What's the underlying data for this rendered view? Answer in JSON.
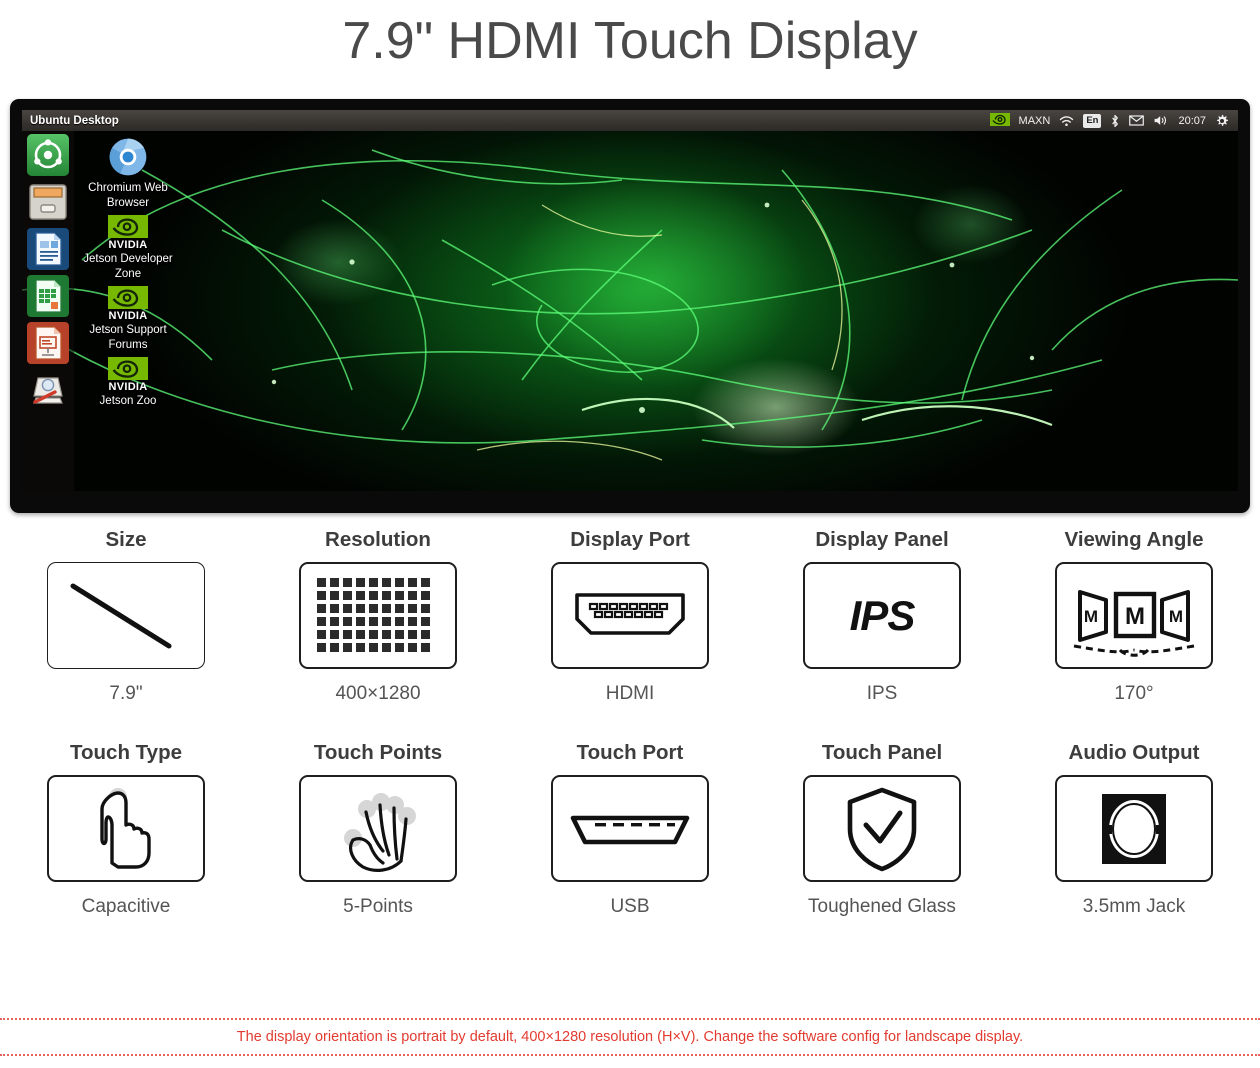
{
  "page": {
    "title": "7.9\" HDMI Touch Display",
    "footer_note": "The display orientation is portrait by default, 400×1280 resolution (H×V). Change the software config for landscape display.",
    "accent_red": "#e23b30",
    "header_gray": "#3d3d3d",
    "value_gray": "#555555"
  },
  "desktop": {
    "panel_title": "Ubuntu Desktop",
    "tray": {
      "nvidia_icon": "nvidia-logo-icon",
      "power_mode": "MAXN",
      "wifi_icon": "wifi-icon",
      "keyboard_layout": "En",
      "bluetooth_icon": "bluetooth-icon",
      "mail_icon": "mail-icon",
      "volume_icon": "volume-icon",
      "clock": "20:07",
      "settings_icon": "gear-icon"
    },
    "launcher": [
      {
        "name": "ubuntu-dash-icon",
        "label": "Ubuntu Dash"
      },
      {
        "name": "files-icon",
        "label": "Files"
      },
      {
        "name": "libreoffice-writer-icon",
        "label": "LibreOffice Writer"
      },
      {
        "name": "libreoffice-calc-icon",
        "label": "LibreOffice Calc"
      },
      {
        "name": "libreoffice-impress-icon",
        "label": "LibreOffice Impress"
      },
      {
        "name": "system-settings-icon",
        "label": "System Settings"
      }
    ],
    "icons": [
      {
        "icon": "chromium-icon",
        "label": "Chromium Web Browser"
      },
      {
        "icon": "nvidia-logo-icon",
        "brand": "NVIDIA",
        "label": "Jetson Developer Zone"
      },
      {
        "icon": "nvidia-logo-icon",
        "brand": "NVIDIA",
        "label": "Jetson Support Forums"
      },
      {
        "icon": "nvidia-logo-icon",
        "brand": "NVIDIA",
        "label": "Jetson Zoo"
      }
    ]
  },
  "specs": [
    {
      "title": "Size",
      "value": "7.9\"",
      "icon": "diagonal-line-icon"
    },
    {
      "title": "Resolution",
      "value": "400×1280",
      "icon": "pixel-grid-icon"
    },
    {
      "title": "Display Port",
      "value": "HDMI",
      "icon": "hdmi-port-icon"
    },
    {
      "title": "Display Panel",
      "value": "IPS",
      "icon": "ips-text-icon",
      "icon_text": "IPS"
    },
    {
      "title": "Viewing Angle",
      "value": "170°",
      "icon": "viewing-angle-icon",
      "panel_letter": "M"
    },
    {
      "title": "Touch Type",
      "value": "Capacitive",
      "icon": "pointing-hand-icon"
    },
    {
      "title": "Touch Points",
      "value": "5-Points",
      "icon": "five-finger-hand-icon"
    },
    {
      "title": "Touch Port",
      "value": "USB",
      "icon": "usb-port-icon"
    },
    {
      "title": "Touch Panel",
      "value": "Toughened Glass",
      "icon": "shield-check-icon"
    },
    {
      "title": "Audio Output",
      "value": "3.5mm Jack",
      "icon": "audio-jack-icon"
    }
  ]
}
